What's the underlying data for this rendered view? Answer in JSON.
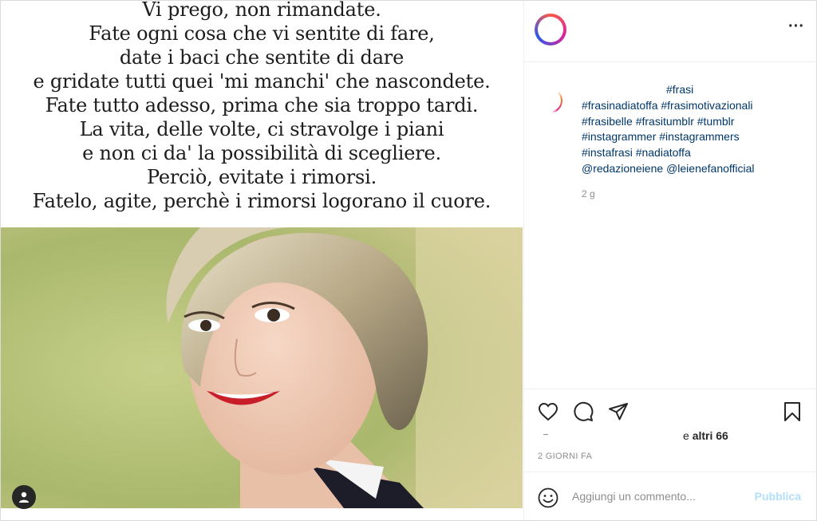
{
  "media": {
    "quote_lines": [
      "Vi prego, non rimandate.",
      "Fate ogni cosa che vi sentite di fare,",
      "date i baci che sentite di dare",
      "e gridate tutti quei 'mi manchi' che nascondete.",
      "Fate tutto adesso, prima che sia troppo tardi.",
      "La vita, delle volte, ci stravolge i piani",
      "e non ci da' la possibilità di scegliere.",
      "Perciò, evitate i rimorsi.",
      "Fatelo, agite, perchè i rimorsi logorano il cuore."
    ],
    "user_tag_icon": "user-tag-icon"
  },
  "header": {
    "more_label": "···"
  },
  "caption": {
    "first_tag": "#frasi",
    "tags": [
      "#frasinadiatoffa",
      "#frasimotivazionali",
      "#frasibelle",
      "#frasitumblr",
      "#tumblr",
      "#instagrammer",
      "#instagrammers",
      "#instafrasi",
      "#nadiatoffa",
      "@redazioneiene",
      "@leienefanofficial"
    ],
    "time": "2 g"
  },
  "actions": {
    "icons": [
      "heart-icon",
      "comment-icon",
      "share-icon",
      "bookmark-icon"
    ]
  },
  "likes": {
    "prefix": "e ",
    "count_label": "altri 66"
  },
  "post_date": "2 GIORNI FA",
  "comment": {
    "placeholder": "Aggiungi un commento...",
    "publish_label": "Pubblica"
  },
  "colors": {
    "link": "#00376b",
    "publish_disabled": "#b2dffc",
    "meta_grey": "#8e8e8e"
  }
}
